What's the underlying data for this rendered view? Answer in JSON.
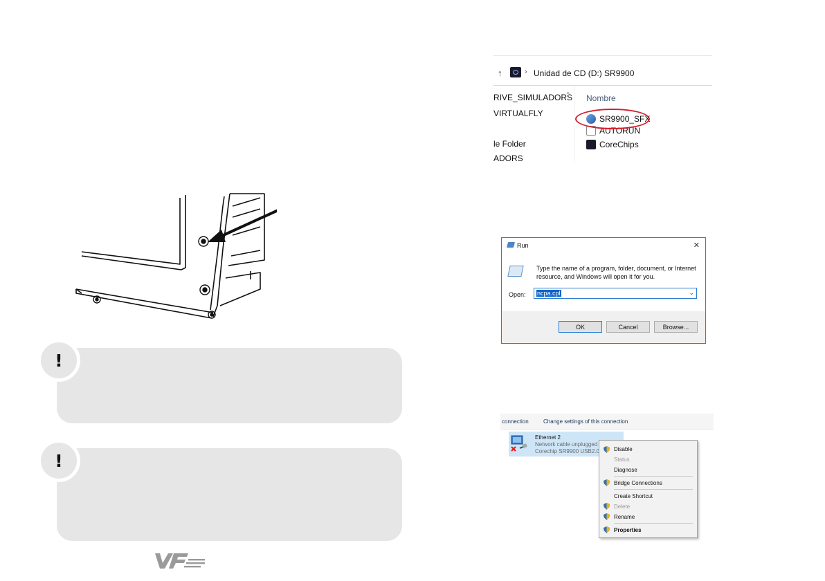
{
  "explorer": {
    "path": "Unidad de CD (D:) SR9900",
    "nav_items": [
      "RIVE_SIMULADORS",
      "VIRTUALFLY",
      "le Folder",
      "ADORS"
    ],
    "column_header": "Nombre",
    "files": [
      {
        "name": "SR9900_SFX",
        "icon": "setup-icon",
        "highlighted": true
      },
      {
        "name": "AUTORUN",
        "icon": "autorun-icon",
        "highlighted": false
      },
      {
        "name": "CoreChips",
        "icon": "corechips-icon",
        "highlighted": false
      }
    ],
    "highlight_color": "#d3212d"
  },
  "run_dialog": {
    "title": "Run",
    "description": "Type the name of a program, folder, document, or Internet resource, and Windows will open it for you.",
    "open_label": "Open:",
    "open_value": "ncpa.cpl",
    "buttons": {
      "ok": "OK",
      "cancel": "Cancel",
      "browse": "Browse..."
    },
    "accent": "#1f83d6"
  },
  "network": {
    "commands": [
      "connection",
      "Change settings of this connection"
    ],
    "connection": {
      "name": "Ethernet 2",
      "status": "Network cable unplugged",
      "device": "Corechip SR9900 USB2.0 to"
    }
  },
  "context_menu": {
    "items": [
      {
        "label": "Disable",
        "shield": true,
        "disabled": false,
        "bold": false
      },
      {
        "label": "Status",
        "shield": false,
        "disabled": true,
        "bold": false
      },
      {
        "label": "Diagnose",
        "shield": false,
        "disabled": false,
        "bold": false
      },
      {
        "label": "Bridge Connections",
        "shield": true,
        "disabled": false,
        "bold": false
      },
      {
        "label": "Create Shortcut",
        "shield": false,
        "disabled": false,
        "bold": false
      },
      {
        "label": "Delete",
        "shield": true,
        "disabled": true,
        "bold": false
      },
      {
        "label": "Rename",
        "shield": true,
        "disabled": false,
        "bold": false
      },
      {
        "label": "Properties",
        "shield": true,
        "disabled": false,
        "bold": true
      }
    ]
  },
  "warnings": [
    {
      "icon": "exclamation-icon",
      "symbol": "!"
    },
    {
      "icon": "exclamation-icon",
      "symbol": "!"
    }
  ]
}
